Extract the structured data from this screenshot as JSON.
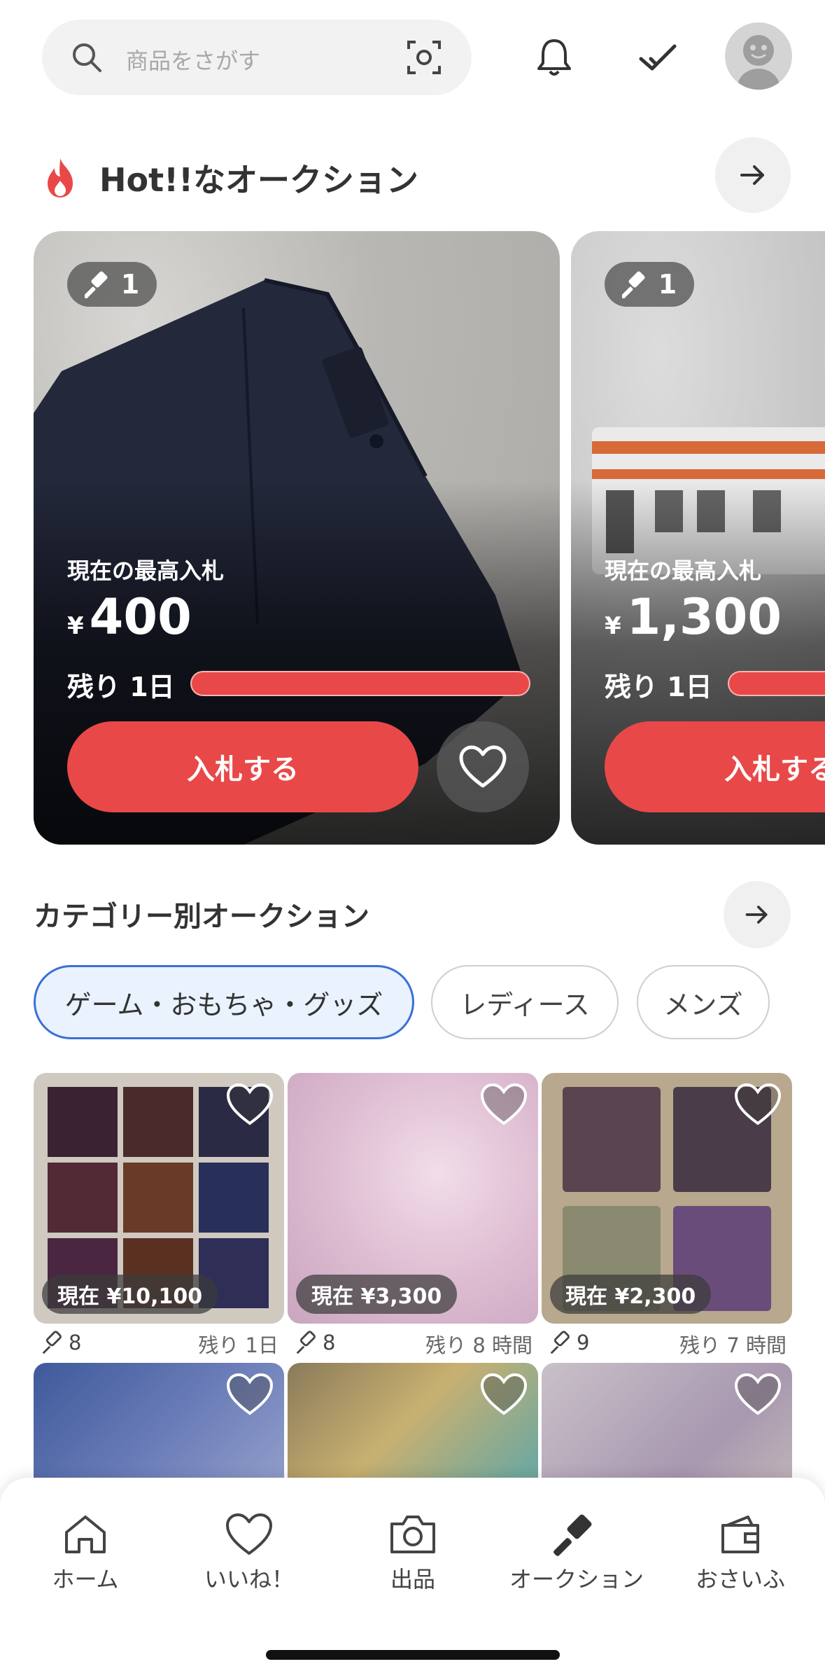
{
  "header": {
    "search_placeholder": "商品をさがす"
  },
  "hot": {
    "title": "Hot!!なオークション",
    "cards": [
      {
        "bids": "1",
        "label": "現在の最高入札",
        "yen": "¥",
        "price": "400",
        "remain": "残り 1日",
        "button": "入札する"
      },
      {
        "bids": "1",
        "label": "現在の最高入札",
        "yen": "¥",
        "price": "1,300",
        "remain": "残り 1日",
        "button": "入札する"
      }
    ]
  },
  "category": {
    "title": "カテゴリー別オークション",
    "chips": [
      "ゲーム・おもちゃ・グッズ",
      "レディース",
      "メンズ"
    ],
    "items": [
      {
        "price": "現在 ¥10,100",
        "bids": "8",
        "remain": "残り 1日"
      },
      {
        "price": "現在 ¥3,300",
        "bids": "8",
        "remain": "残り 8 時間"
      },
      {
        "price": "現在 ¥2,300",
        "bids": "9",
        "remain": "残り 7 時間"
      }
    ]
  },
  "nav": {
    "items": [
      "ホーム",
      "いいね！",
      "出品",
      "オークション",
      "おさいふ"
    ]
  },
  "colors": {
    "accent": "#e94848",
    "chip_active_border": "#3a6fd8",
    "chip_active_bg": "#e9f2fd"
  },
  "icons": [
    "search-icon",
    "camera-scan-icon",
    "bell-icon",
    "check-icon",
    "avatar",
    "flame-icon",
    "arrow-right-icon",
    "gavel-icon",
    "heart-icon",
    "home-icon",
    "camera-icon",
    "wallet-icon"
  ]
}
